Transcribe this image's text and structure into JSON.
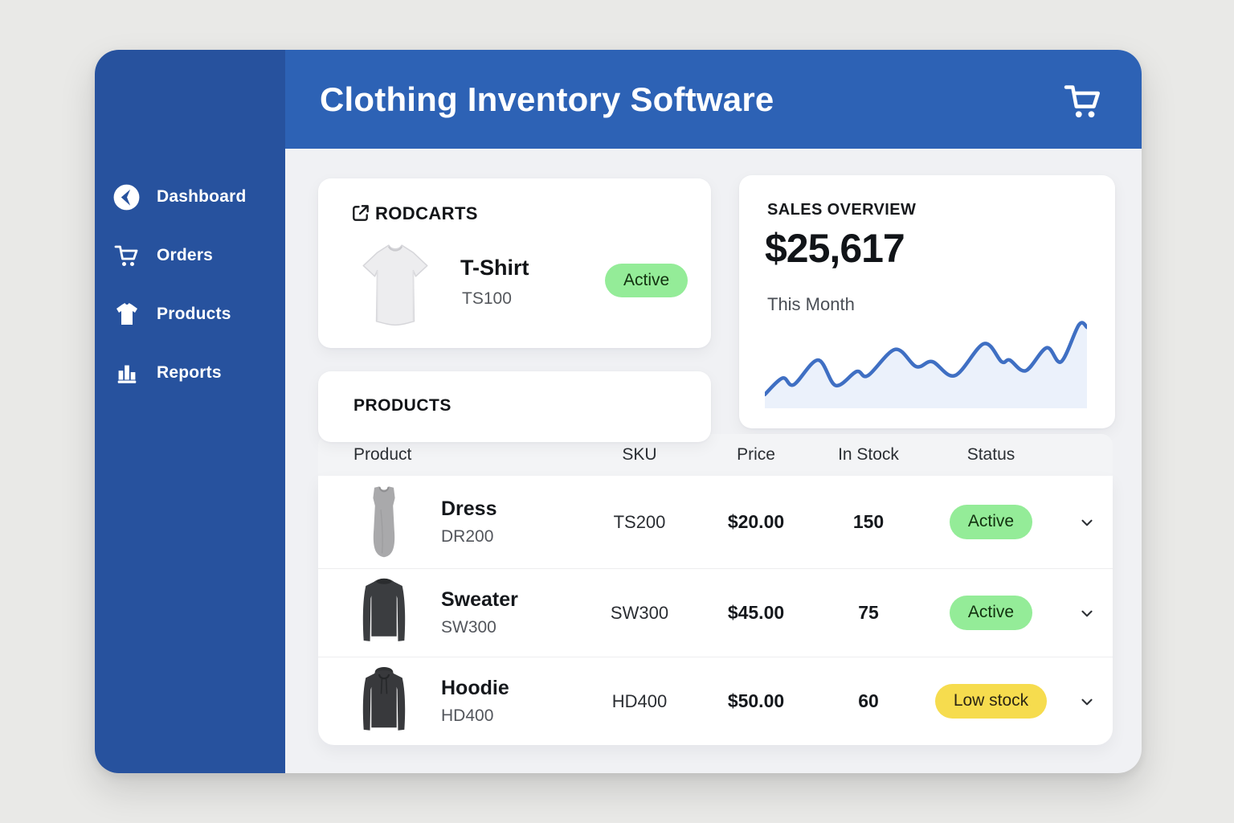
{
  "header": {
    "title": "Clothing Inventory Software",
    "cart_icon": "shopping-cart"
  },
  "sidebar": {
    "items": [
      {
        "label": "Dashboard",
        "icon": "dashboard-clock-icon"
      },
      {
        "label": "Orders",
        "icon": "cart-icon"
      },
      {
        "label": "Products",
        "icon": "t-shirt-icon"
      },
      {
        "label": "Reports",
        "icon": "bar-chart-icon"
      }
    ]
  },
  "featured_product": {
    "brand": "RODCARTS",
    "logo_icon": "arrow-box-icon",
    "name": "T-Shirt",
    "sku": "TS100",
    "status": "Active",
    "image": "white-t-shirt-photo"
  },
  "sales_overview": {
    "title": "SALES OVERVIEW",
    "amount": "$25,617",
    "period": "This Month"
  },
  "chart_data": {
    "type": "area",
    "title": "Sales Overview — This Month",
    "x": [
      0,
      5.5,
      9,
      16.5,
      22,
      28.5,
      32,
      40.5,
      47,
      52,
      59,
      68,
      73.5,
      76,
      81,
      87.5,
      92,
      97.5,
      100
    ],
    "values": [
      10,
      30,
      22,
      52,
      21,
      38,
      33,
      65,
      44,
      50,
      33,
      72,
      50,
      52,
      39,
      67,
      50,
      95,
      92
    ],
    "xlabel": "",
    "ylabel": "",
    "ylim": [
      0,
      100
    ],
    "axes_visible": false,
    "grid": false,
    "legend": "none",
    "line_color": "#3f6fc3",
    "fill_color": "#e8eefa"
  },
  "products_table": {
    "title": "PRODUCTS",
    "columns": [
      "Product",
      "SKU",
      "Price",
      "In Stock",
      "Status"
    ],
    "rows": [
      {
        "name": "Dress",
        "code": "DR200",
        "sku": "TS200",
        "price": "$20.00",
        "stock": "150",
        "status": "Active",
        "status_type": "active",
        "image": "gray-dress-photo"
      },
      {
        "name": "Sweater",
        "code": "SW300",
        "sku": "SW300",
        "price": "$45.00",
        "stock": "75",
        "status": "Active",
        "status_type": "active",
        "image": "dark-sweater-photo"
      },
      {
        "name": "Hoodie",
        "code": "HD400",
        "sku": "HD400",
        "price": "$50.00",
        "stock": "60",
        "status": "Low stock",
        "status_type": "low-stock",
        "image": "dark-hoodie-photo"
      }
    ]
  },
  "colors": {
    "page_bg": "#e9e9e7",
    "content_bg": "#f0f1f4",
    "sidebar_bg": "#27529e",
    "header_bg": "#2d62b5",
    "card_bg": "#ffffff",
    "table_header_bg": "#f3f4f6",
    "badge_active_bg": "#94ec98",
    "badge_low_stock_bg": "#f6dc4e",
    "chart_line": "#3f6fc3",
    "chart_fill": "#e8eefa"
  }
}
